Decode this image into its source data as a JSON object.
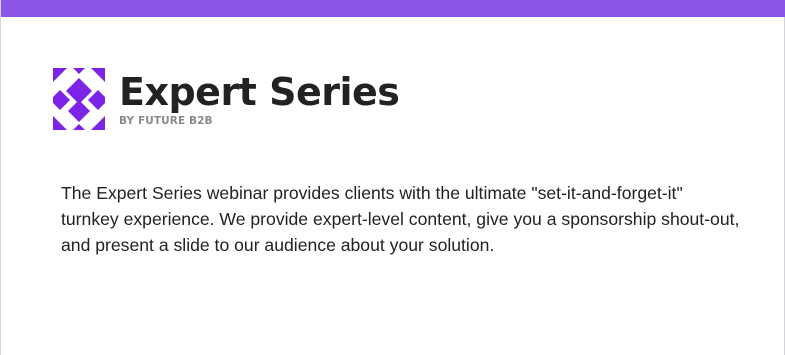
{
  "brand": {
    "title": "Expert Series",
    "subtitle": "BY FUTURE B2B",
    "logo_icon": "crossed-x-logo-icon",
    "accent_color": "#8b55e5",
    "logo_color": "#7c23e8"
  },
  "description": "The Expert Series webinar provides clients with the ultimate \"set-it-and-forget-it\" turnkey experience. We provide expert-level content, give you a sponsorship shout-out, and present a slide to our audience about your solution."
}
